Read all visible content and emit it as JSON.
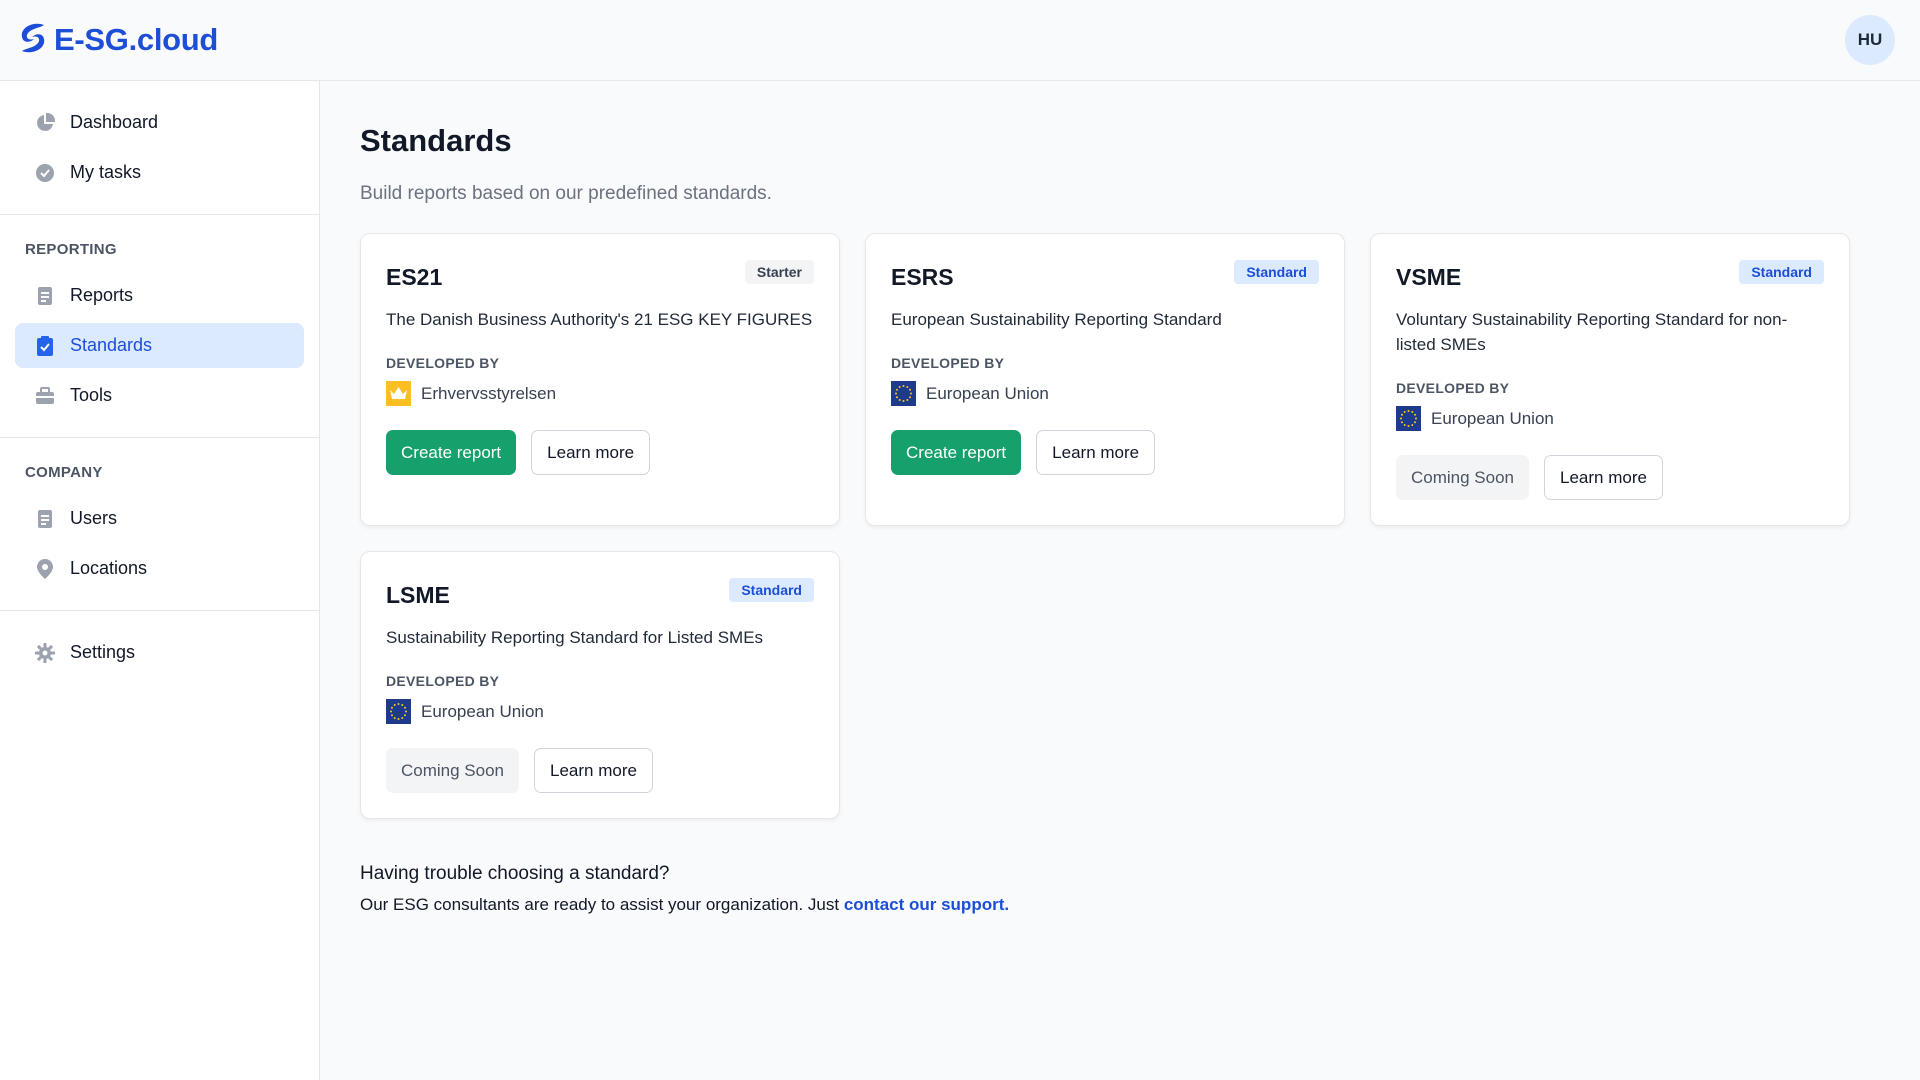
{
  "brand": {
    "name": "E-SG.cloud"
  },
  "user": {
    "initials": "HU"
  },
  "sidebar": {
    "top_items": [
      {
        "label": "Dashboard",
        "icon": "pie-chart-icon"
      },
      {
        "label": "My tasks",
        "icon": "check-circle-icon"
      }
    ],
    "reporting": {
      "heading": "REPORTING",
      "items": [
        {
          "label": "Reports",
          "icon": "document-icon"
        },
        {
          "label": "Standards",
          "icon": "clipboard-check-icon",
          "active": true
        },
        {
          "label": "Tools",
          "icon": "toolbox-icon"
        }
      ]
    },
    "company": {
      "heading": "COMPANY",
      "items": [
        {
          "label": "Users",
          "icon": "users-icon"
        },
        {
          "label": "Locations",
          "icon": "map-pin-icon"
        }
      ]
    },
    "bottom_items": [
      {
        "label": "Settings",
        "icon": "gear-icon"
      }
    ]
  },
  "page": {
    "title": "Standards",
    "subtitle": "Build reports based on our predefined standards."
  },
  "cards": [
    {
      "name": "ES21",
      "badge": "Starter",
      "description": "The Danish Business Authority's 21 ESG KEY FIGURES",
      "developed_by_label": "DEVELOPED BY",
      "developer": "Erhvervsstyrelsen",
      "primary_action": "Create report",
      "secondary_action": "Learn more"
    },
    {
      "name": "ESRS",
      "badge": "Standard",
      "description": "European Sustainability Reporting Standard",
      "developed_by_label": "DEVELOPED BY",
      "developer": "European Union",
      "primary_action": "Create report",
      "secondary_action": "Learn more"
    },
    {
      "name": "VSME",
      "badge": "Standard",
      "description": "Voluntary Sustainability Reporting Standard for non-listed SMEs",
      "developed_by_label": "DEVELOPED BY",
      "developer": "European Union",
      "primary_action": "Coming Soon",
      "secondary_action": "Learn more"
    },
    {
      "name": "LSME",
      "badge": "Standard",
      "description": "Sustainability Reporting Standard for Listed SMEs",
      "developed_by_label": "DEVELOPED BY",
      "developer": "European Union",
      "primary_action": "Coming Soon",
      "secondary_action": "Learn more"
    }
  ],
  "help": {
    "title": "Having trouble choosing a standard?",
    "text": "Our ESG consultants are ready to assist your organization. Just",
    "link": "contact our support."
  },
  "colors": {
    "brand_blue": "#1d4ed8",
    "primary_green": "#16a06c",
    "active_bg": "#dbeafe"
  }
}
